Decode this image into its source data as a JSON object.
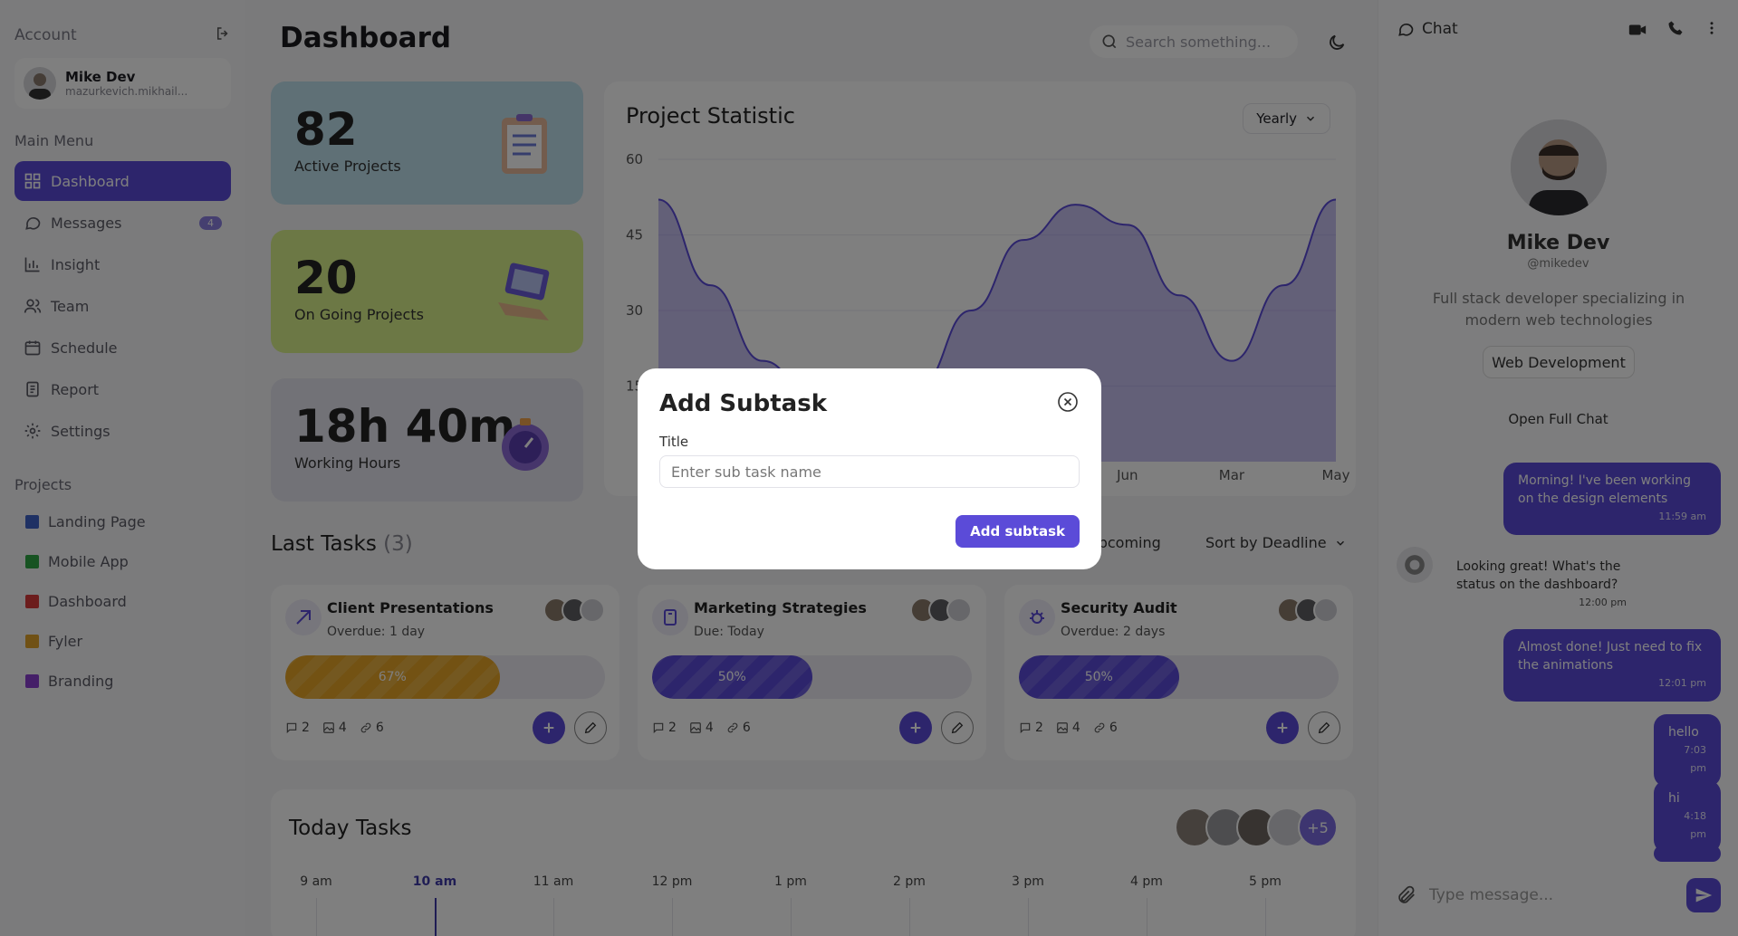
{
  "sidebar": {
    "account_label": "Account",
    "user": {
      "name": "Mike Dev",
      "email": "mazurkevich.mikhail..."
    },
    "main_menu_label": "Main Menu",
    "items": [
      {
        "label": "Dashboard",
        "icon": "dashboard-icon",
        "active": true
      },
      {
        "label": "Messages",
        "icon": "chat-icon",
        "badge": "4"
      },
      {
        "label": "Insight",
        "icon": "chart-icon"
      },
      {
        "label": "Team",
        "icon": "users-icon"
      },
      {
        "label": "Schedule",
        "icon": "calendar-icon"
      },
      {
        "label": "Report",
        "icon": "report-icon"
      },
      {
        "label": "Settings",
        "icon": "gear-icon"
      }
    ],
    "projects_label": "Projects",
    "projects": [
      {
        "label": "Landing Page",
        "color": "#3f63c9"
      },
      {
        "label": "Mobile App",
        "color": "#2fa644"
      },
      {
        "label": "Dashboard",
        "color": "#d93a3a"
      },
      {
        "label": "Fyler",
        "color": "#e0a22a"
      },
      {
        "label": "Branding",
        "color": "#8a3fd1"
      }
    ]
  },
  "header": {
    "title": "Dashboard",
    "search_placeholder": "Search something..."
  },
  "stats": [
    {
      "value": "82",
      "label": "Active Projects",
      "color": "#bfe0ec"
    },
    {
      "value": "20",
      "label": "On Going Projects",
      "color": "#d9f08a"
    },
    {
      "value": "18h 40m",
      "label": "Working Hours",
      "color": "#e4e4ee"
    }
  ],
  "project_statistic": {
    "title": "Project Statistic",
    "period": "Yearly",
    "visible_x_labels": [
      "Jun",
      "Mar",
      "May"
    ],
    "accent": "#5b4bd8"
  },
  "chart_data": {
    "type": "area",
    "title": "Project Statistic",
    "ylim": [
      0,
      60
    ],
    "yticks": [
      "60",
      "45",
      "30",
      "15"
    ],
    "x": [
      "",
      "",
      "",
      "",
      "",
      "",
      "",
      "",
      "",
      "Jun",
      "",
      "Mar",
      "",
      "May"
    ],
    "values": [
      52,
      35,
      20,
      12,
      8,
      15,
      30,
      44,
      51,
      47,
      33,
      20,
      35,
      52
    ]
  },
  "last_tasks": {
    "title": "Last Tasks",
    "count": "(3)",
    "filter_upcoming": "Upcoming",
    "sort": "Sort by Deadline",
    "items": [
      {
        "name": "Client Presentations",
        "due": "Overdue: 1 day",
        "progress": "67%",
        "progress_value": 0.67,
        "fill": "#e6a526",
        "comments": "2",
        "files": "4",
        "links": "6"
      },
      {
        "name": "Marketing Strategies",
        "due": "Due: Today",
        "progress": "50%",
        "progress_value": 0.5,
        "fill": "#5b4bd8",
        "comments": "2",
        "files": "4",
        "links": "6"
      },
      {
        "name": "Security Audit",
        "due": "Overdue: 2 days",
        "progress": "50%",
        "progress_value": 0.5,
        "fill": "#5b4bd8",
        "comments": "2",
        "files": "4",
        "links": "6"
      }
    ]
  },
  "today_tasks": {
    "title": "Today Tasks",
    "more": "+5",
    "times": [
      "9 am",
      "10 am",
      "11 am",
      "12 pm",
      "1 pm",
      "2 pm",
      "3 pm",
      "4 pm",
      "5 pm"
    ]
  },
  "chat": {
    "title": "Chat",
    "profile": {
      "name": "Mike Dev",
      "handle": "@mikedev",
      "bio": "Full stack developer specializing in modern web technologies",
      "tag": "Web Development"
    },
    "open_full_chat": "Open Full Chat",
    "messages": [
      {
        "text": "Morning! I've been working on the design elements",
        "time": "11:59 am",
        "me": true
      },
      {
        "text": "Looking great! What's the status on the dashboard?",
        "time": "12:00 pm",
        "me": false
      },
      {
        "text": "Almost done! Just need to fix the animations",
        "time": "12:01 pm",
        "me": true
      },
      {
        "text": "hello",
        "time": "7:03 pm",
        "me": true
      },
      {
        "text": "hi",
        "time": "4:18 pm",
        "me": true
      }
    ],
    "input_placeholder": "Type message..."
  },
  "modal": {
    "title": "Add Subtask",
    "field_label": "Title",
    "placeholder": "Enter sub task name",
    "button": "Add subtask"
  }
}
